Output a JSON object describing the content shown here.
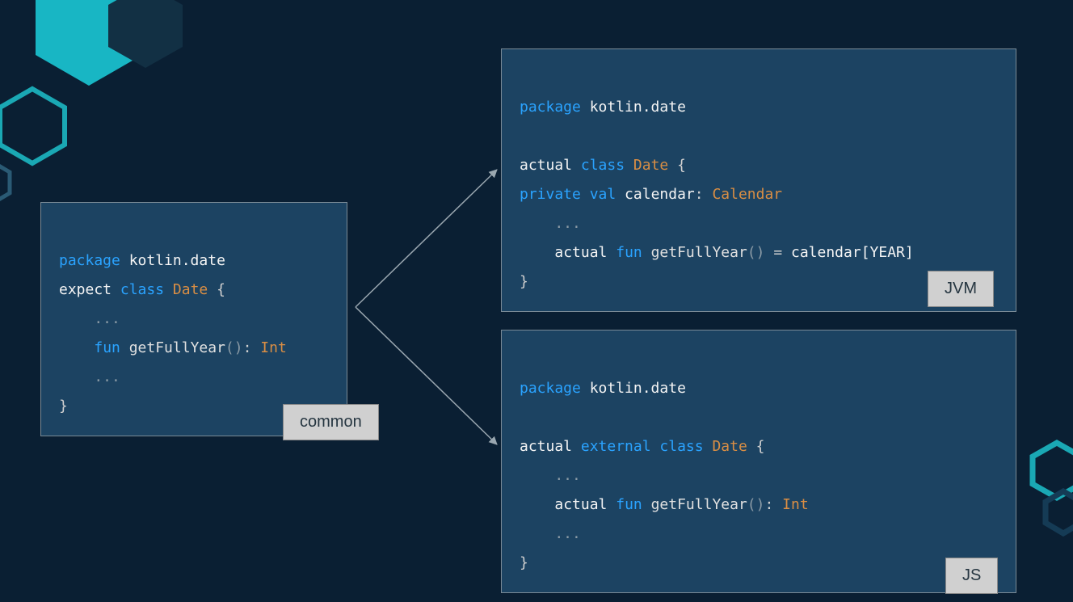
{
  "common": {
    "label": "common",
    "code": {
      "line1_package": "package",
      "line1_rest": " kotlin.date",
      "line2_expect": "expect",
      "line2_class": "class",
      "line2_type": "Date",
      "line2_end": " {",
      "line3": "    ...",
      "line4_fun": "fun",
      "line4_name": " getFullYear",
      "line4_paren": "()",
      "line4_colon": ": ",
      "line4_ret": "Int",
      "line5": "    ...",
      "line6": "}"
    }
  },
  "jvm": {
    "label": "JVM",
    "code": {
      "line1_package": "package",
      "line1_rest": " kotlin.date",
      "blank": " ",
      "line3_actual": "actual",
      "line3_class": "class",
      "line3_type": "Date",
      "line3_end": " {",
      "line4_private": "private",
      "line4_val": "val",
      "line4_name": " calendar",
      "line4_colon": ": ",
      "line4_type": "Calendar",
      "line5": "    ...",
      "line6_actual": "actual",
      "line6_fun": "fun",
      "line6_name": " getFullYear",
      "line6_paren": "()",
      "line6_eq": " = ",
      "line6_rhs": "calendar[YEAR]",
      "line7": "}"
    }
  },
  "js": {
    "label": "JS",
    "code": {
      "line1_package": "package",
      "line1_rest": " kotlin.date",
      "blank": " ",
      "line3_actual": "actual",
      "line3_external": "external",
      "line3_class": "class",
      "line3_type": "Date",
      "line3_end": " {",
      "line4": "    ...",
      "line5_actual": "actual",
      "line5_fun": "fun",
      "line5_name": " getFullYear",
      "line5_paren": "()",
      "line5_colon": ": ",
      "line5_ret": "Int",
      "line6": "    ...",
      "line7": "}"
    }
  }
}
